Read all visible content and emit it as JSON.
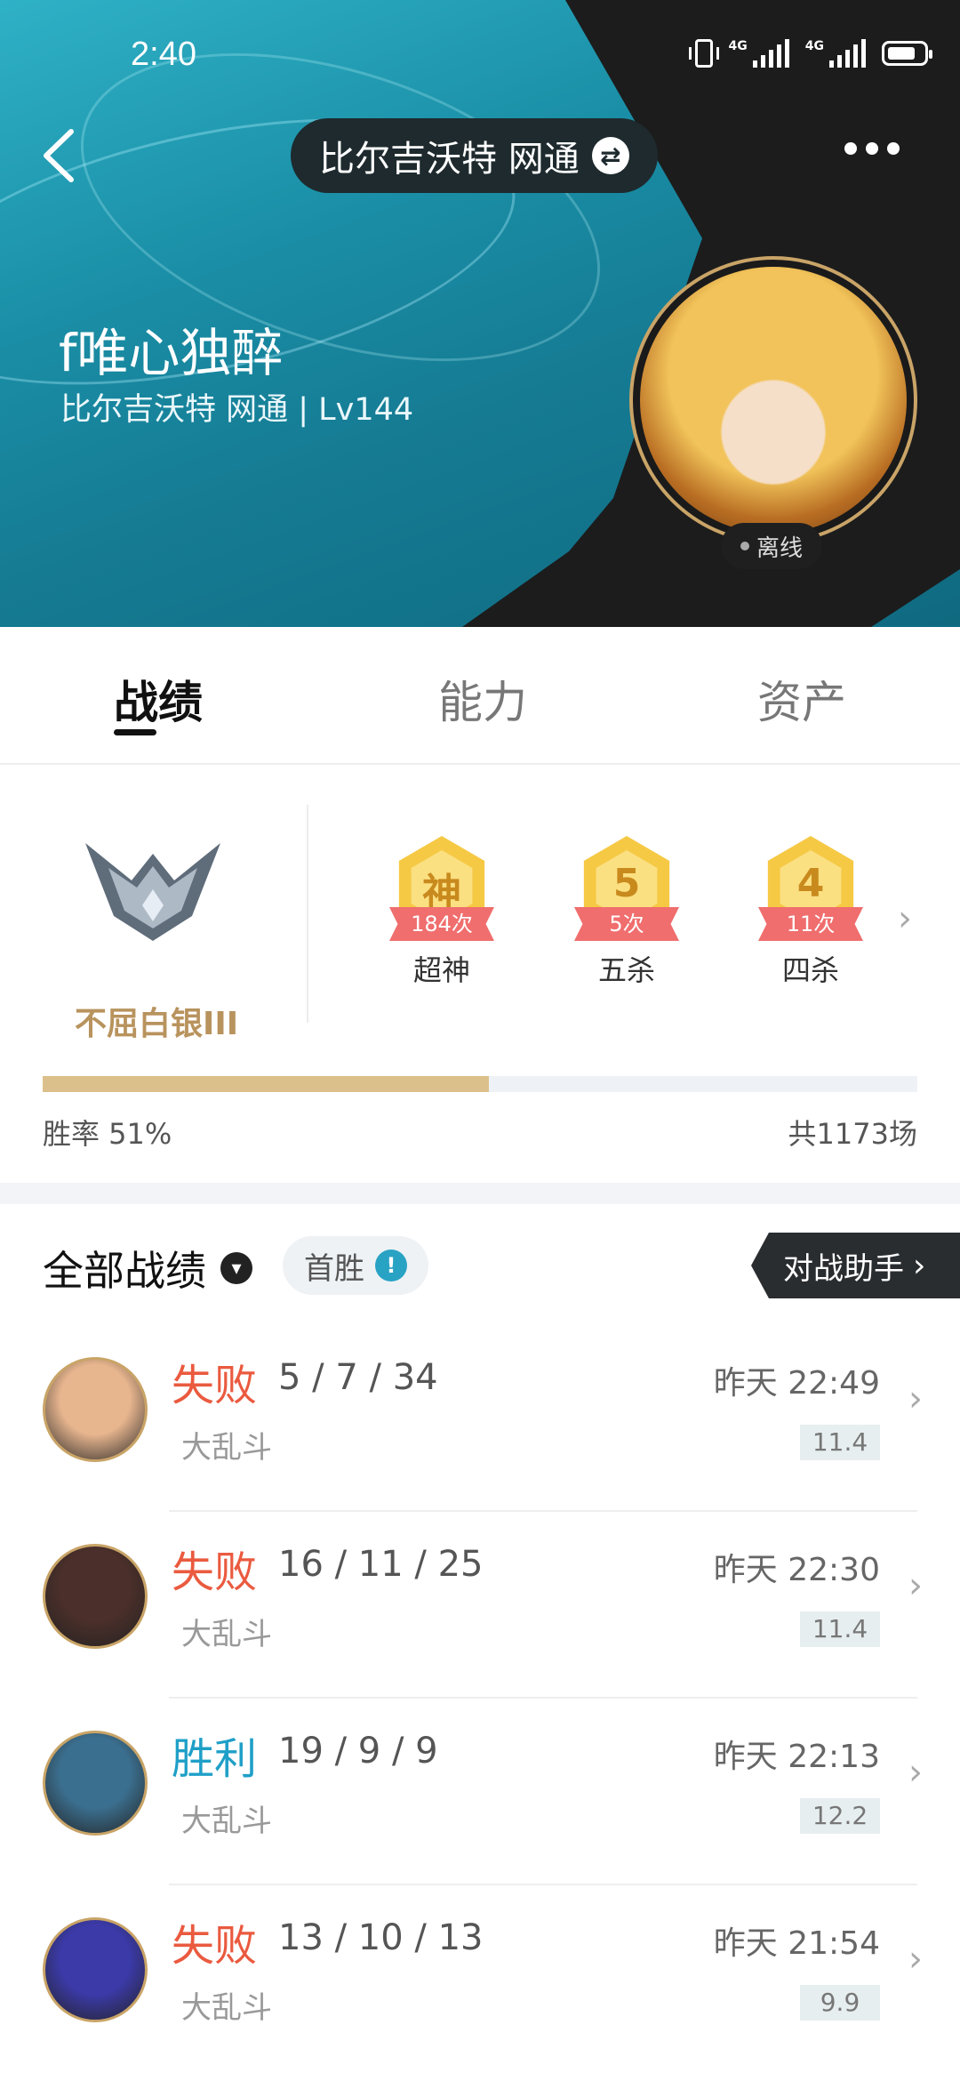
{
  "status_bar": {
    "time": "2:40",
    "network1": "4G",
    "network2": "4G"
  },
  "header": {
    "server_switch": "比尔吉沃特 网通",
    "player_name": "f唯心独醉",
    "player_subtitle": "比尔吉沃特 网通 | Lv144",
    "online_status": "离线"
  },
  "tabs": [
    {
      "label": "战绩",
      "active": true
    },
    {
      "label": "能力",
      "active": false
    },
    {
      "label": "资产",
      "active": false
    }
  ],
  "rank": {
    "name": "不屈白银III"
  },
  "achievements": [
    {
      "glyph": "神",
      "count": "184次",
      "label": "超神"
    },
    {
      "glyph": "5",
      "count": "5次",
      "label": "五杀"
    },
    {
      "glyph": "4",
      "count": "11次",
      "label": "四杀"
    }
  ],
  "winrate": {
    "label": "胜率  51%",
    "fraction": 0.51,
    "total": "共1173场"
  },
  "filters": {
    "all": "全部战绩",
    "first_win": "首胜",
    "helper": "对战助手"
  },
  "matches": [
    {
      "result": "失败",
      "win": false,
      "kda": "5 / 7 / 34",
      "mode": "大乱斗",
      "time": "昨天 22:49",
      "score": "11.4",
      "hero_color": "#e7b58e"
    },
    {
      "result": "失败",
      "win": false,
      "kda": "16 / 11 / 25",
      "mode": "大乱斗",
      "time": "昨天 22:30",
      "score": "11.4",
      "hero_color": "#4b2f2a"
    },
    {
      "result": "胜利",
      "win": true,
      "kda": "19 / 9 / 9",
      "mode": "大乱斗",
      "time": "昨天 22:13",
      "score": "12.2",
      "hero_color": "#3b6f8f"
    },
    {
      "result": "失败",
      "win": false,
      "kda": "13 / 10 / 13",
      "mode": "大乱斗",
      "time": "昨天 21:54",
      "score": "9.9",
      "hero_color": "#3b3aa8"
    }
  ]
}
